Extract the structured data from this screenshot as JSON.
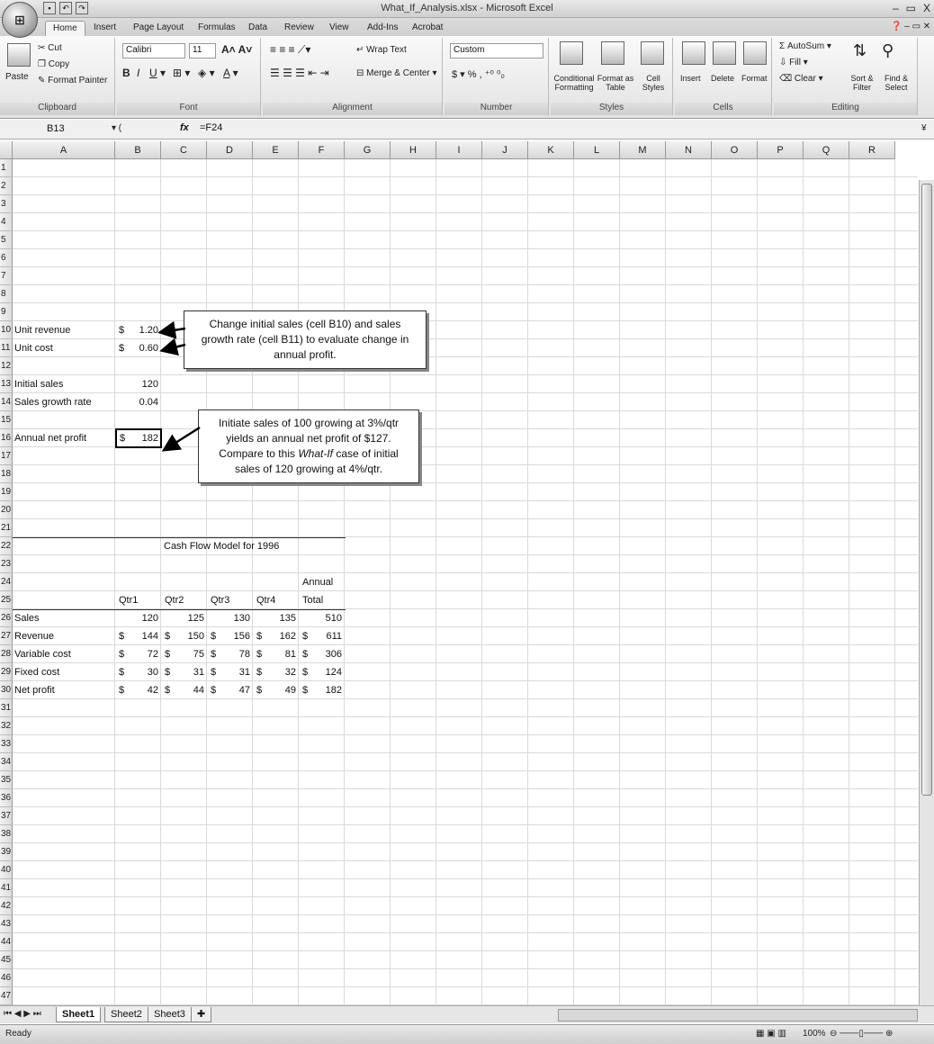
{
  "window": {
    "title": "What_If_Analysis.xlsx - Microsoft Excel",
    "controls": [
      "–",
      "▭",
      "X"
    ]
  },
  "tabs": [
    "Home",
    "Insert",
    "Page Layout",
    "Formulas",
    "Data",
    "Review",
    "View",
    "Add-Ins",
    "Acrobat"
  ],
  "ribbon": {
    "clipboard": {
      "paste": "Paste",
      "cut": "Cut",
      "copy": "Copy",
      "format_painter": "Format Painter",
      "label": "Clipboard"
    },
    "font": {
      "name": "Calibri",
      "size": "11",
      "label": "Font"
    },
    "alignment": {
      "wrap": "Wrap Text",
      "merge": "Merge & Center",
      "label": "Alignment"
    },
    "number": {
      "format": "Custom",
      "label": "Number"
    },
    "styles": {
      "conditional": "Conditional Formatting",
      "format_table": "Format as Table",
      "cell_styles": "Cell Styles",
      "label": "Styles"
    },
    "cells": {
      "insert": "Insert",
      "delete": "Delete",
      "format": "Format",
      "label": "Cells"
    },
    "editing": {
      "autosum": "AutoSum",
      "fill": "Fill",
      "clear": "Clear",
      "sort": "Sort & Filter",
      "find": "Find & Select",
      "label": "Editing"
    }
  },
  "formula_bar": {
    "name_box": "B13",
    "fx": "fx",
    "formula": "=F24"
  },
  "columns": [
    "A",
    "B",
    "C",
    "D",
    "E",
    "F",
    "G",
    "H",
    "I",
    "J",
    "K",
    "L",
    "M",
    "N",
    "O",
    "P",
    "Q",
    "R"
  ],
  "cells": {
    "unit_revenue_label": "Unit revenue",
    "unit_revenue_cur": "$",
    "unit_revenue": "1.20",
    "unit_cost_label": "Unit cost",
    "unit_cost_cur": "$",
    "unit_cost": "0.60",
    "initial_sales_label": "Initial sales",
    "initial_sales": "120",
    "growth_label": "Sales growth rate",
    "growth": "0.04",
    "net_profit_label": "Annual net profit",
    "net_profit_cur": "$",
    "net_profit": "182",
    "model_title": "Cash Flow Model for 1996",
    "annual": "Annual",
    "headers": [
      "Qtr1",
      "Qtr2",
      "Qtr3",
      "Qtr4",
      "Total"
    ],
    "rows": [
      {
        "label": "Sales",
        "cur": false,
        "values": [
          "120",
          "125",
          "130",
          "135",
          "510"
        ]
      },
      {
        "label": "Revenue",
        "cur": true,
        "values": [
          "144",
          "150",
          "156",
          "162",
          "611"
        ]
      },
      {
        "label": "Variable cost",
        "cur": true,
        "values": [
          "72",
          "75",
          "78",
          "81",
          "306"
        ]
      },
      {
        "label": "Fixed cost",
        "cur": true,
        "values": [
          "30",
          "31",
          "31",
          "32",
          "124"
        ]
      },
      {
        "label": "Net profit",
        "cur": true,
        "values": [
          "42",
          "44",
          "47",
          "49",
          "182"
        ]
      }
    ]
  },
  "callouts": {
    "top": [
      "Change initial sales (cell B10) and sales",
      "growth rate (cell B11) to evaluate change in",
      "annual profit."
    ],
    "bottom_l1": "Initiate sales of 100 growing at 3%/qtr",
    "bottom_l2": "yields an annual net profit of $127.",
    "bottom_l3a": "Compare to this ",
    "bottom_l3b": "What-If",
    "bottom_l3c": " case of initial",
    "bottom_l4": "sales of 120 growing at 4%/qtr."
  },
  "sheets": [
    "Sheet1",
    "Sheet2",
    "Sheet3"
  ],
  "status": {
    "ready": "Ready",
    "zoom": "100%"
  }
}
